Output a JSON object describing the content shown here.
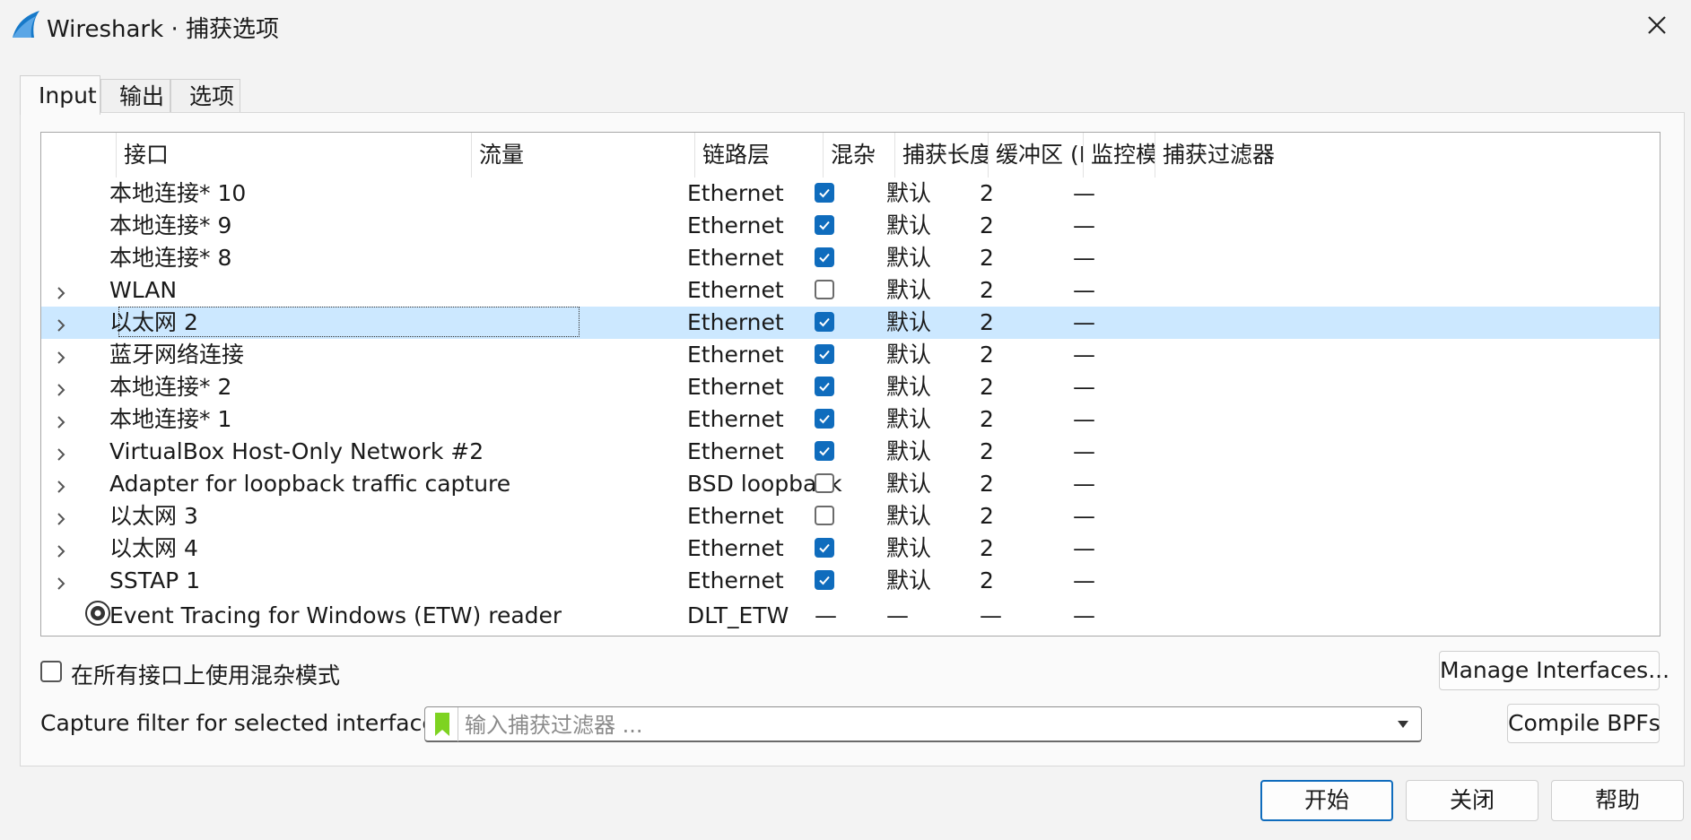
{
  "window": {
    "title": "Wireshark · 捕获选项"
  },
  "tabs": [
    {
      "label": "Input",
      "active": true
    },
    {
      "label": "输出",
      "active": false
    },
    {
      "label": "选项",
      "active": false
    }
  ],
  "table": {
    "columns": [
      "接口",
      "流量",
      "链路层",
      "混杂",
      "捕获长度 (",
      "缓冲区 (M",
      "监控模式",
      "捕获过滤器"
    ],
    "rows": [
      {
        "expandable": false,
        "interface": "本地连接* 10",
        "link": "Ethernet",
        "promisc": true,
        "snaplen": "默认",
        "buffer": "2",
        "monitor": "—"
      },
      {
        "expandable": false,
        "interface": "本地连接* 9",
        "link": "Ethernet",
        "promisc": true,
        "snaplen": "默认",
        "buffer": "2",
        "monitor": "—"
      },
      {
        "expandable": false,
        "interface": "本地连接* 8",
        "link": "Ethernet",
        "promisc": true,
        "snaplen": "默认",
        "buffer": "2",
        "monitor": "—"
      },
      {
        "expandable": true,
        "interface": "WLAN",
        "link": "Ethernet",
        "promisc": false,
        "snaplen": "默认",
        "buffer": "2",
        "monitor": "—"
      },
      {
        "expandable": true,
        "interface": "以太网 2",
        "link": "Ethernet",
        "promisc": true,
        "snaplen": "默认",
        "buffer": "2",
        "monitor": "—",
        "selected": true
      },
      {
        "expandable": true,
        "interface": "蓝牙网络连接",
        "link": "Ethernet",
        "promisc": true,
        "snaplen": "默认",
        "buffer": "2",
        "monitor": "—"
      },
      {
        "expandable": true,
        "interface": "本地连接* 2",
        "link": "Ethernet",
        "promisc": true,
        "snaplen": "默认",
        "buffer": "2",
        "monitor": "—"
      },
      {
        "expandable": true,
        "interface": "本地连接* 1",
        "link": "Ethernet",
        "promisc": true,
        "snaplen": "默认",
        "buffer": "2",
        "monitor": "—"
      },
      {
        "expandable": true,
        "interface": "VirtualBox Host-Only Network #2",
        "link": "Ethernet",
        "promisc": true,
        "snaplen": "默认",
        "buffer": "2",
        "monitor": "—"
      },
      {
        "expandable": true,
        "interface": "Adapter for loopback traffic capture",
        "link": "BSD loopback",
        "promisc": false,
        "snaplen": "默认",
        "buffer": "2",
        "monitor": "—"
      },
      {
        "expandable": true,
        "interface": "以太网 3",
        "link": "Ethernet",
        "promisc": false,
        "snaplen": "默认",
        "buffer": "2",
        "monitor": "—"
      },
      {
        "expandable": true,
        "interface": "以太网 4",
        "link": "Ethernet",
        "promisc": true,
        "snaplen": "默认",
        "buffer": "2",
        "monitor": "—"
      },
      {
        "expandable": true,
        "interface": "SSTAP 1",
        "link": "Ethernet",
        "promisc": true,
        "snaplen": "默认",
        "buffer": "2",
        "monitor": "—"
      },
      {
        "expandable": false,
        "icon": "gear-icon",
        "interface": "Event Tracing for Windows (ETW) reader",
        "link": "DLT_ETW",
        "promisc_text": "—",
        "snaplen": "—",
        "buffer": "—",
        "monitor": "—"
      }
    ]
  },
  "promisc_all": {
    "label": "在所有接口上使用混杂模式",
    "checked": false
  },
  "manage_interfaces_label": "Manage Interfaces...",
  "capture_filter": {
    "label": "Capture filter for selected interfaces:",
    "placeholder": "输入捕获过滤器 ...",
    "value": ""
  },
  "compile_bpfs_label": "Compile BPFs",
  "buttons": {
    "start": "开始",
    "close": "关闭",
    "help": "帮助"
  },
  "colors": {
    "accent": "#0f6cbd",
    "selection": "#cce8ff",
    "bookmark": "#7ed321"
  }
}
